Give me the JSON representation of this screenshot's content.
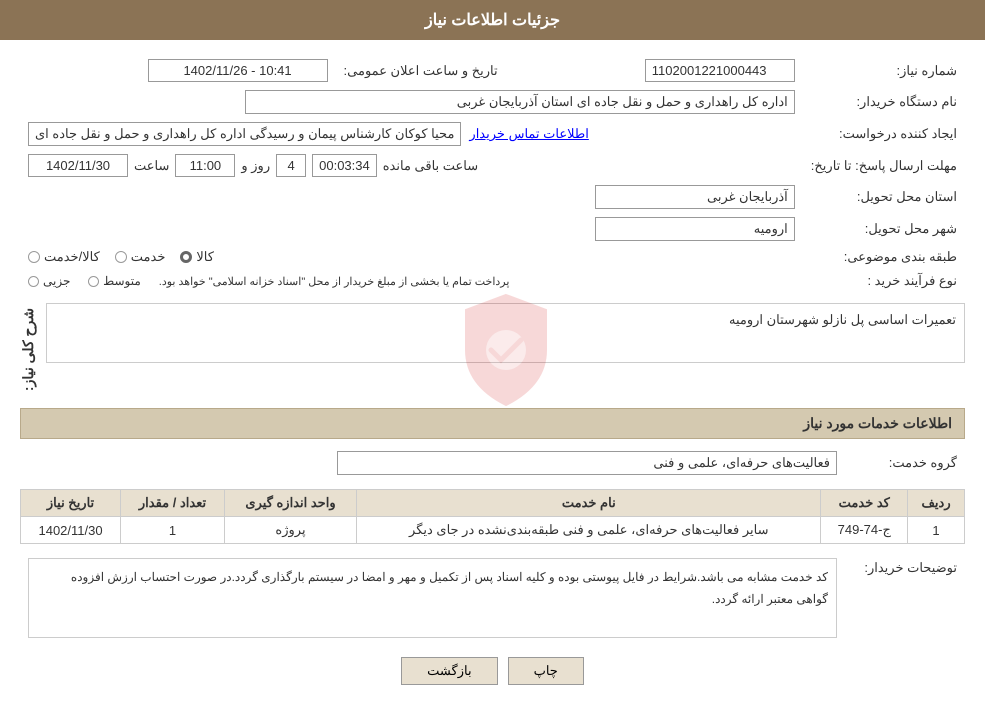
{
  "header": {
    "title": "جزئیات اطلاعات نیاز"
  },
  "fields": {
    "need_number_label": "شماره نیاز:",
    "need_number_value": "1102001221000443",
    "buyer_org_label": "نام دستگاه خریدار:",
    "buyer_org_value": "اداره کل راهداری و حمل و نقل جاده ای استان آذربایجان غربی",
    "creator_label": "ایجاد کننده درخواست:",
    "creator_value": "محیا کوکان کارشناس پیمان و رسیدگی اداره کل راهداری و حمل و نقل جاده ای",
    "contact_link": "اطلاعات تماس خریدار",
    "deadline_label": "مهلت ارسال پاسخ: تا تاریخ:",
    "deadline_date": "1402/11/30",
    "deadline_time_label": "ساعت",
    "deadline_time": "11:00",
    "deadline_days_label": "روز و",
    "deadline_days": "4",
    "deadline_remaining_label": "ساعت باقی مانده",
    "deadline_remaining": "00:03:34",
    "announcement_label": "تاریخ و ساعت اعلان عمومی:",
    "announcement_value": "1402/11/26 - 10:41",
    "province_label": "استان محل تحویل:",
    "province_value": "آذربایجان غربی",
    "city_label": "شهر محل تحویل:",
    "city_value": "ارومیه",
    "category_label": "طبقه بندی موضوعی:",
    "category_options": [
      "خدمت",
      "کالا",
      "کالا/خدمت"
    ],
    "category_selected": "کالا",
    "purchase_type_label": "نوع فرآیند خرید :",
    "purchase_types": [
      "جزیی",
      "متوسط"
    ],
    "purchase_note": "پرداخت تمام یا بخشی از مبلغ خریدار از محل \"اسناد خزانه اسلامی\" خواهد بود.",
    "description_label": "شرح کلی نیاز:",
    "description_value": "تعمیرات اساسی پل نازلو شهرستان ارومیه",
    "services_label": "اطلاعات خدمات مورد نیاز",
    "service_group_label": "گروه خدمت:",
    "service_group_value": "فعالیت‌های حرفه‌ای، علمی و فنی",
    "table_headers": [
      "ردیف",
      "کد خدمت",
      "نام خدمت",
      "واحد اندازه گیری",
      "تعداد / مقدار",
      "تاریخ نیاز"
    ],
    "table_rows": [
      {
        "row": "1",
        "code": "ج-74-749",
        "name": "سایر فعالیت‌های حرفه‌ای، علمی و فنی طبقه‌بندی‌نشده در جای دیگر",
        "unit": "پروژه",
        "quantity": "1",
        "date": "1402/11/30"
      }
    ],
    "buyer_notes_label": "توضیحات خریدار:",
    "buyer_notes_value": "کد خدمت مشابه می باشد.شرایط در فایل پیوستی بوده و کلیه اسناد پس از تکمیل و مهر و امضا در سیستم بارگذاری گردد.در صورت احتساب ارزش افزوده گواهی معتبر ارائه گردد.",
    "btn_back": "بازگشت",
    "btn_print": "چاپ"
  }
}
